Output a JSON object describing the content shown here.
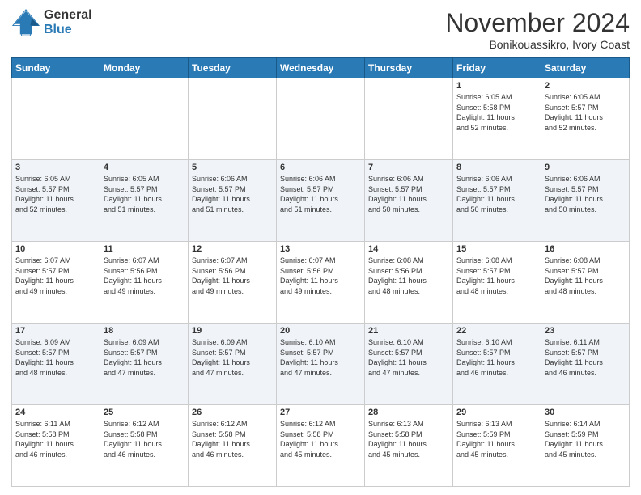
{
  "header": {
    "logo": {
      "general": "General",
      "blue": "Blue"
    },
    "title": "November 2024",
    "location": "Bonikouassikro, Ivory Coast"
  },
  "weekdays": [
    "Sunday",
    "Monday",
    "Tuesday",
    "Wednesday",
    "Thursday",
    "Friday",
    "Saturday"
  ],
  "weeks": [
    [
      {
        "day": "",
        "info": ""
      },
      {
        "day": "",
        "info": ""
      },
      {
        "day": "",
        "info": ""
      },
      {
        "day": "",
        "info": ""
      },
      {
        "day": "",
        "info": ""
      },
      {
        "day": "1",
        "info": "Sunrise: 6:05 AM\nSunset: 5:58 PM\nDaylight: 11 hours\nand 52 minutes."
      },
      {
        "day": "2",
        "info": "Sunrise: 6:05 AM\nSunset: 5:57 PM\nDaylight: 11 hours\nand 52 minutes."
      }
    ],
    [
      {
        "day": "3",
        "info": "Sunrise: 6:05 AM\nSunset: 5:57 PM\nDaylight: 11 hours\nand 52 minutes."
      },
      {
        "day": "4",
        "info": "Sunrise: 6:05 AM\nSunset: 5:57 PM\nDaylight: 11 hours\nand 51 minutes."
      },
      {
        "day": "5",
        "info": "Sunrise: 6:06 AM\nSunset: 5:57 PM\nDaylight: 11 hours\nand 51 minutes."
      },
      {
        "day": "6",
        "info": "Sunrise: 6:06 AM\nSunset: 5:57 PM\nDaylight: 11 hours\nand 51 minutes."
      },
      {
        "day": "7",
        "info": "Sunrise: 6:06 AM\nSunset: 5:57 PM\nDaylight: 11 hours\nand 50 minutes."
      },
      {
        "day": "8",
        "info": "Sunrise: 6:06 AM\nSunset: 5:57 PM\nDaylight: 11 hours\nand 50 minutes."
      },
      {
        "day": "9",
        "info": "Sunrise: 6:06 AM\nSunset: 5:57 PM\nDaylight: 11 hours\nand 50 minutes."
      }
    ],
    [
      {
        "day": "10",
        "info": "Sunrise: 6:07 AM\nSunset: 5:57 PM\nDaylight: 11 hours\nand 49 minutes."
      },
      {
        "day": "11",
        "info": "Sunrise: 6:07 AM\nSunset: 5:56 PM\nDaylight: 11 hours\nand 49 minutes."
      },
      {
        "day": "12",
        "info": "Sunrise: 6:07 AM\nSunset: 5:56 PM\nDaylight: 11 hours\nand 49 minutes."
      },
      {
        "day": "13",
        "info": "Sunrise: 6:07 AM\nSunset: 5:56 PM\nDaylight: 11 hours\nand 49 minutes."
      },
      {
        "day": "14",
        "info": "Sunrise: 6:08 AM\nSunset: 5:56 PM\nDaylight: 11 hours\nand 48 minutes."
      },
      {
        "day": "15",
        "info": "Sunrise: 6:08 AM\nSunset: 5:57 PM\nDaylight: 11 hours\nand 48 minutes."
      },
      {
        "day": "16",
        "info": "Sunrise: 6:08 AM\nSunset: 5:57 PM\nDaylight: 11 hours\nand 48 minutes."
      }
    ],
    [
      {
        "day": "17",
        "info": "Sunrise: 6:09 AM\nSunset: 5:57 PM\nDaylight: 11 hours\nand 48 minutes."
      },
      {
        "day": "18",
        "info": "Sunrise: 6:09 AM\nSunset: 5:57 PM\nDaylight: 11 hours\nand 47 minutes."
      },
      {
        "day": "19",
        "info": "Sunrise: 6:09 AM\nSunset: 5:57 PM\nDaylight: 11 hours\nand 47 minutes."
      },
      {
        "day": "20",
        "info": "Sunrise: 6:10 AM\nSunset: 5:57 PM\nDaylight: 11 hours\nand 47 minutes."
      },
      {
        "day": "21",
        "info": "Sunrise: 6:10 AM\nSunset: 5:57 PM\nDaylight: 11 hours\nand 47 minutes."
      },
      {
        "day": "22",
        "info": "Sunrise: 6:10 AM\nSunset: 5:57 PM\nDaylight: 11 hours\nand 46 minutes."
      },
      {
        "day": "23",
        "info": "Sunrise: 6:11 AM\nSunset: 5:57 PM\nDaylight: 11 hours\nand 46 minutes."
      }
    ],
    [
      {
        "day": "24",
        "info": "Sunrise: 6:11 AM\nSunset: 5:58 PM\nDaylight: 11 hours\nand 46 minutes."
      },
      {
        "day": "25",
        "info": "Sunrise: 6:12 AM\nSunset: 5:58 PM\nDaylight: 11 hours\nand 46 minutes."
      },
      {
        "day": "26",
        "info": "Sunrise: 6:12 AM\nSunset: 5:58 PM\nDaylight: 11 hours\nand 46 minutes."
      },
      {
        "day": "27",
        "info": "Sunrise: 6:12 AM\nSunset: 5:58 PM\nDaylight: 11 hours\nand 45 minutes."
      },
      {
        "day": "28",
        "info": "Sunrise: 6:13 AM\nSunset: 5:58 PM\nDaylight: 11 hours\nand 45 minutes."
      },
      {
        "day": "29",
        "info": "Sunrise: 6:13 AM\nSunset: 5:59 PM\nDaylight: 11 hours\nand 45 minutes."
      },
      {
        "day": "30",
        "info": "Sunrise: 6:14 AM\nSunset: 5:59 PM\nDaylight: 11 hours\nand 45 minutes."
      }
    ]
  ]
}
